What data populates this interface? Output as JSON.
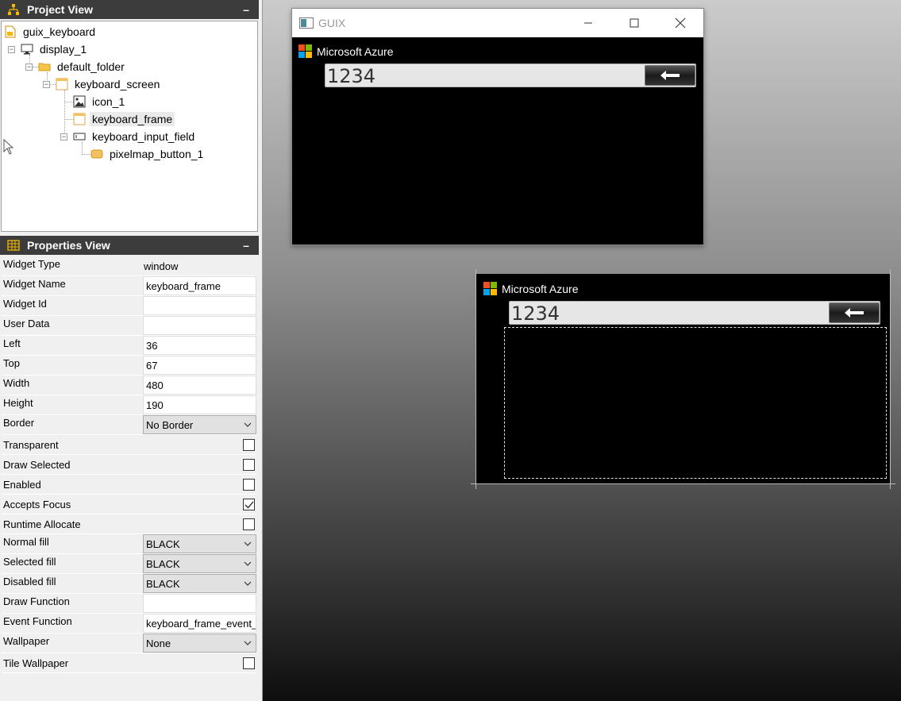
{
  "project_view": {
    "title": "Project View",
    "minimize": "–",
    "tree": [
      {
        "label": "guix_keyboard",
        "icon": "project-icon"
      },
      {
        "label": "display_1",
        "icon": "display-icon"
      },
      {
        "label": "default_folder",
        "icon": "folder-icon"
      },
      {
        "label": "keyboard_screen",
        "icon": "window-icon"
      },
      {
        "label": "icon_1",
        "icon": "image-icon"
      },
      {
        "label": "keyboard_frame",
        "icon": "window-icon",
        "selected": true
      },
      {
        "label": "keyboard_input_field",
        "icon": "input-field-icon"
      },
      {
        "label": "pixelmap_button_1",
        "icon": "button-icon"
      }
    ]
  },
  "properties_view": {
    "title": "Properties View",
    "minimize": "–",
    "rows": [
      {
        "label": "Widget Type",
        "value": "window",
        "kind": "readonly"
      },
      {
        "label": "Widget Name",
        "value": "keyboard_frame",
        "kind": "text"
      },
      {
        "label": "Widget Id",
        "value": "",
        "kind": "text"
      },
      {
        "label": "User Data",
        "value": "",
        "kind": "text"
      },
      {
        "label": "Left",
        "value": "36",
        "kind": "text"
      },
      {
        "label": "Top",
        "value": "67",
        "kind": "text"
      },
      {
        "label": "Width",
        "value": "480",
        "kind": "text"
      },
      {
        "label": "Height",
        "value": "190",
        "kind": "text"
      },
      {
        "label": "Border",
        "value": "No Border",
        "kind": "select"
      },
      {
        "label": "Transparent",
        "checked": false,
        "kind": "check"
      },
      {
        "label": "Draw Selected",
        "checked": false,
        "kind": "check"
      },
      {
        "label": "Enabled",
        "checked": false,
        "kind": "check"
      },
      {
        "label": "Accepts Focus",
        "checked": true,
        "kind": "check"
      },
      {
        "label": "Runtime Allocate",
        "checked": false,
        "kind": "check"
      },
      {
        "label": "Normal fill",
        "value": "BLACK",
        "kind": "select"
      },
      {
        "label": "Selected fill",
        "value": "BLACK",
        "kind": "select"
      },
      {
        "label": "Disabled fill",
        "value": "BLACK",
        "kind": "select"
      },
      {
        "label": "Draw Function",
        "value": "",
        "kind": "text"
      },
      {
        "label": "Event Function",
        "value": "keyboard_frame_event_l",
        "kind": "text"
      },
      {
        "label": "Wallpaper",
        "value": "None",
        "kind": "select"
      },
      {
        "label": "Tile Wallpaper",
        "checked": false,
        "kind": "check"
      }
    ]
  },
  "guix_window": {
    "title": "GUIX",
    "logo_text": "Microsoft Azure",
    "field_value": "1234"
  },
  "design_frame": {
    "logo_text": "Microsoft Azure",
    "field_value": "1234"
  },
  "colors": {
    "ms_red": "#f25022",
    "ms_green": "#7fba00",
    "ms_blue": "#00a4ef",
    "ms_yellow": "#ffb900",
    "header_bg": "#3c3c3c"
  }
}
